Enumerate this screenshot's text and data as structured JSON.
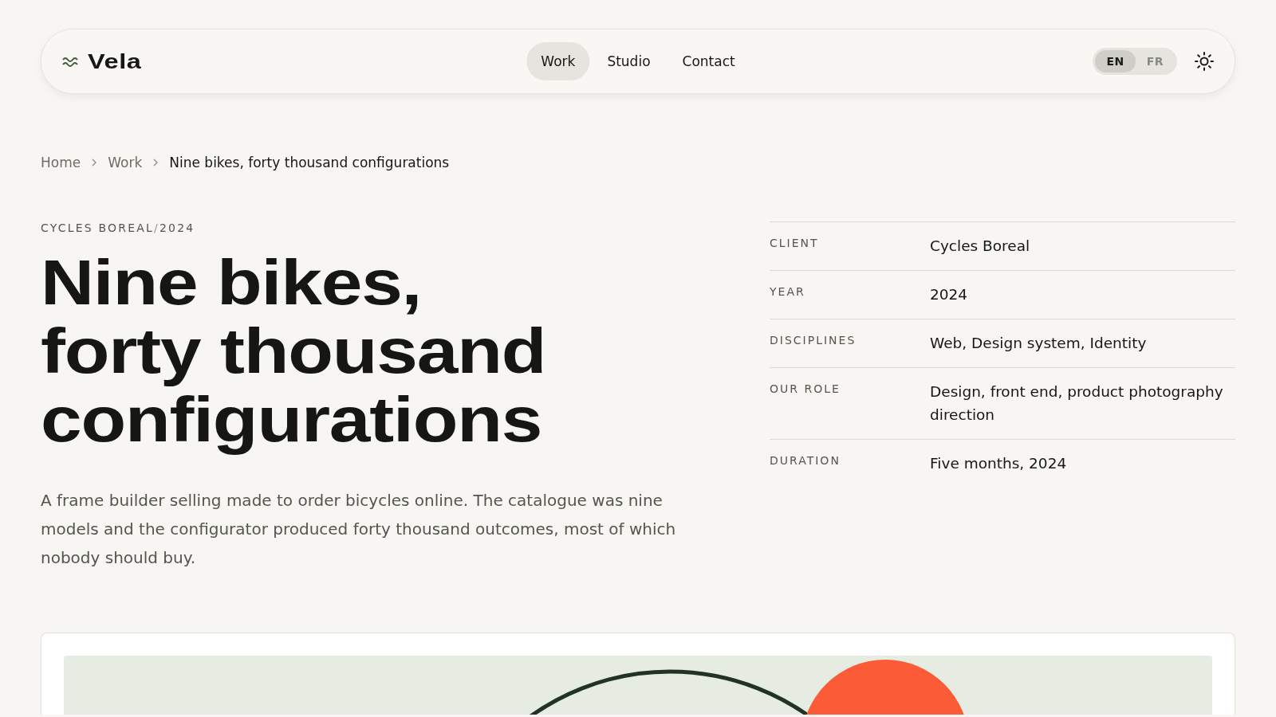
{
  "nav": {
    "brand": "Vela",
    "links": [
      {
        "label": "Work",
        "selected": true
      },
      {
        "label": "Studio",
        "selected": false
      },
      {
        "label": "Contact",
        "selected": false
      }
    ],
    "languages": [
      {
        "label": "EN",
        "selected": true
      },
      {
        "label": "FR",
        "selected": false
      }
    ]
  },
  "breadcrumb": [
    {
      "label": "Home",
      "current": false
    },
    {
      "label": "Work",
      "current": false
    },
    {
      "label": "Nine bikes, forty thousand configurations",
      "current": true
    }
  ],
  "eyebrow": {
    "client": "CYCLES BOREAL",
    "separator": "/",
    "year": "2024"
  },
  "title": [
    "Nine bikes,",
    "forty thousand",
    "configurations"
  ],
  "summary": "A frame builder selling made to order bicycles online. The catalogue was nine models and the configurator produced forty thousand outcomes, most of which nobody should buy.",
  "facts": [
    {
      "label": "CLIENT",
      "value": "Cycles Boreal"
    },
    {
      "label": "YEAR",
      "value": "2024"
    },
    {
      "label": "DISCIPLINES",
      "value": "Web, Design system, Identity"
    },
    {
      "label": "OUR ROLE",
      "value": "Design, front end, product photography direction"
    },
    {
      "label": "DURATION",
      "value": "Five months, 2024"
    }
  ]
}
